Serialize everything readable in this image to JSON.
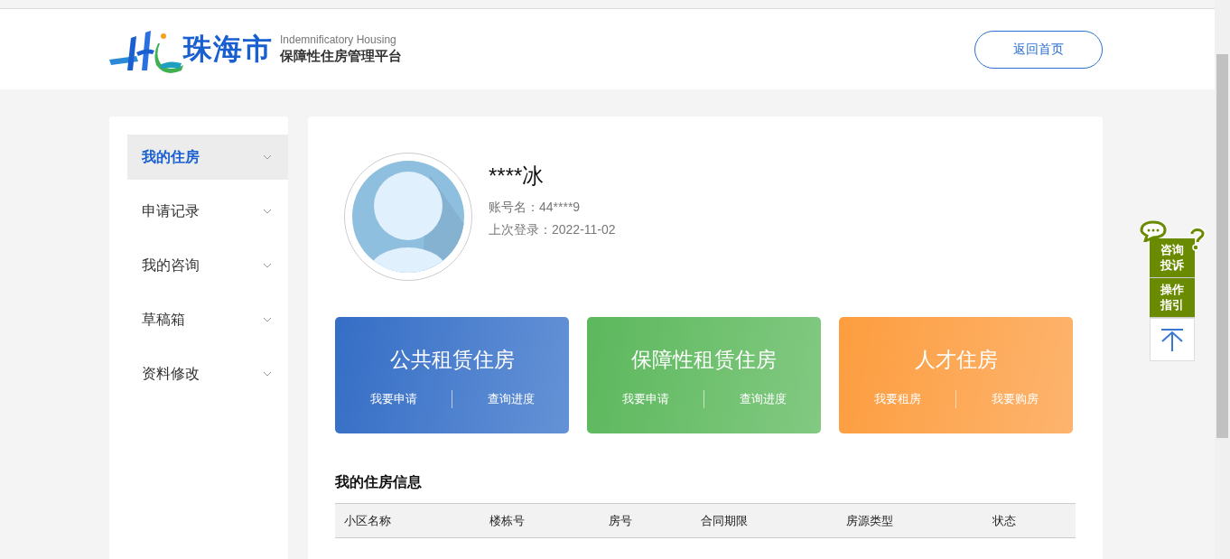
{
  "header": {
    "logo_city": "珠海市",
    "logo_subtitle_en": "Indemnificatory Housing",
    "logo_subtitle_cn": "保障性住房管理平台",
    "home_button": "返回首页"
  },
  "sidebar": {
    "items": [
      {
        "label": "我的住房",
        "selected": true
      },
      {
        "label": "申请记录",
        "selected": false
      },
      {
        "label": "我的咨询",
        "selected": false
      },
      {
        "label": "草稿箱",
        "selected": false
      },
      {
        "label": "资料修改",
        "selected": false
      }
    ]
  },
  "profile": {
    "name": "****冰",
    "account_label": "账号名：",
    "account": "44****9",
    "last_login_label": "上次登录：",
    "last_login": "2022-11-02"
  },
  "cards": [
    {
      "kind": "blue",
      "title": "公共租赁住房",
      "links": [
        "我要申请",
        "查询进度"
      ]
    },
    {
      "kind": "green",
      "title": "保障性租赁住房",
      "links": [
        "我要申请",
        "查询进度"
      ]
    },
    {
      "kind": "orange",
      "title": "人才住房",
      "links": [
        "我要租房",
        "我要购房"
      ]
    }
  ],
  "housing_info": {
    "title": "我的住房信息",
    "columns": [
      "小区名称",
      "楼栋号",
      "房号",
      "合同期限",
      "房源类型",
      "状态"
    ]
  },
  "float_menu": {
    "consult": "咨询投诉",
    "guide": "操作指引"
  }
}
